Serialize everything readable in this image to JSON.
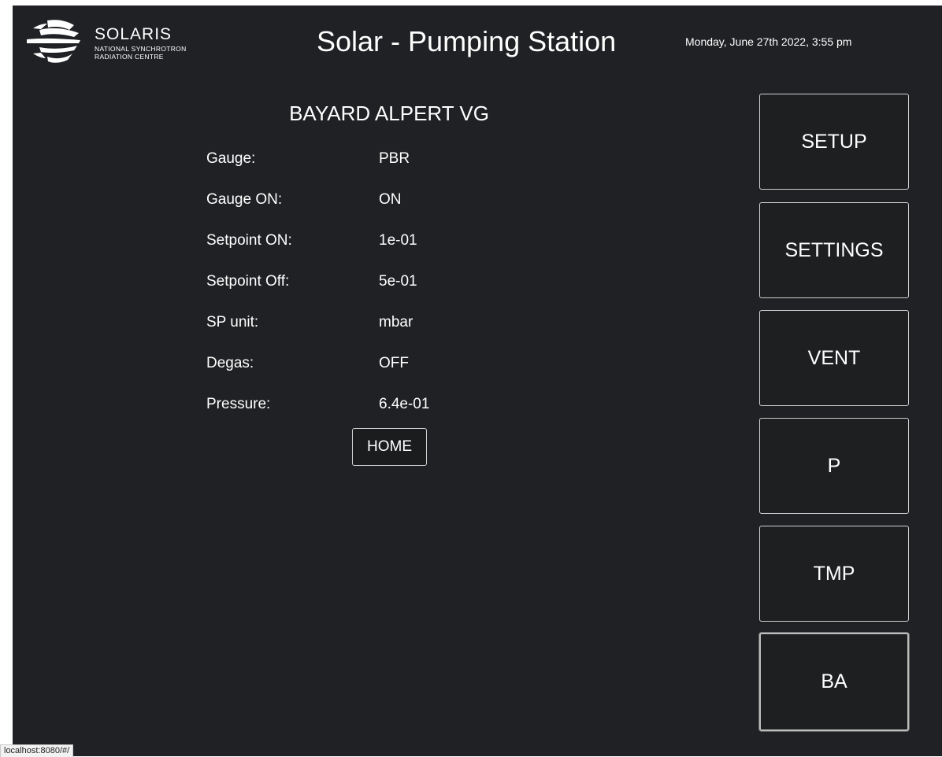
{
  "header": {
    "logo": {
      "brand": "SOLARIS",
      "subtitle": "NATIONAL SYNCHROTRON\nRADIATION CENTRE",
      "icon": "solaris-sunburst-logo"
    },
    "title": "Solar - Pumping Station",
    "datetime": "Monday, June 27th 2022, 3:55 pm"
  },
  "panel": {
    "title": "BAYARD ALPERT VG",
    "rows": [
      {
        "label": "Gauge:",
        "value": "PBR"
      },
      {
        "label": "Gauge ON:",
        "value": "ON"
      },
      {
        "label": "Setpoint ON:",
        "value": "1e-01"
      },
      {
        "label": "Setpoint Off:",
        "value": "5e-01"
      },
      {
        "label": "SP unit:",
        "value": "mbar"
      },
      {
        "label": "Degas:",
        "value": "OFF"
      },
      {
        "label": "Pressure:",
        "value": "6.4e-01"
      }
    ],
    "home_label": "HOME"
  },
  "nav": {
    "buttons": [
      {
        "label": "SETUP"
      },
      {
        "label": "SETTINGS"
      },
      {
        "label": "VENT"
      },
      {
        "label": "P"
      },
      {
        "label": "TMP"
      },
      {
        "label": "BA"
      }
    ],
    "active": "BA"
  },
  "status_bar": {
    "url": "localhost:8080/#/"
  },
  "colors": {
    "background": "#202124",
    "text": "#ffffff",
    "button_border": "#cfcfcf"
  }
}
